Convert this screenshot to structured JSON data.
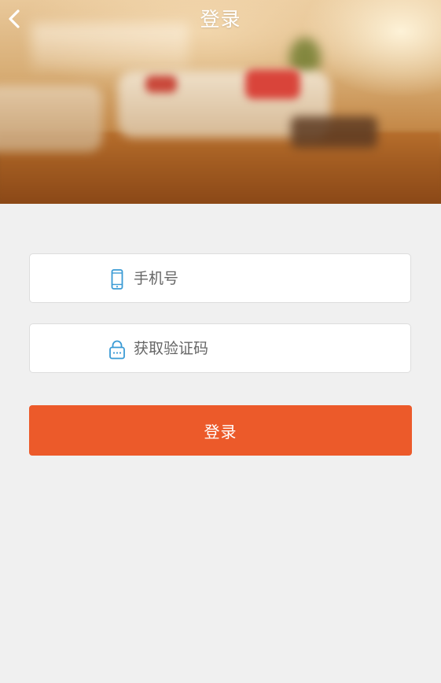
{
  "header": {
    "title": "登录",
    "back_icon": "chevron-left-icon"
  },
  "form": {
    "phone": {
      "icon": "mobile-phone-icon",
      "placeholder": "手机号",
      "value": ""
    },
    "code": {
      "icon": "lock-icon",
      "placeholder": "获取验证码",
      "value": ""
    },
    "submit_label": "登录"
  },
  "colors": {
    "accent": "#ec5a2a",
    "icon": "#3a9bd5",
    "background": "#f0f0f0",
    "field_border": "#dddddd",
    "placeholder": "#666666"
  }
}
